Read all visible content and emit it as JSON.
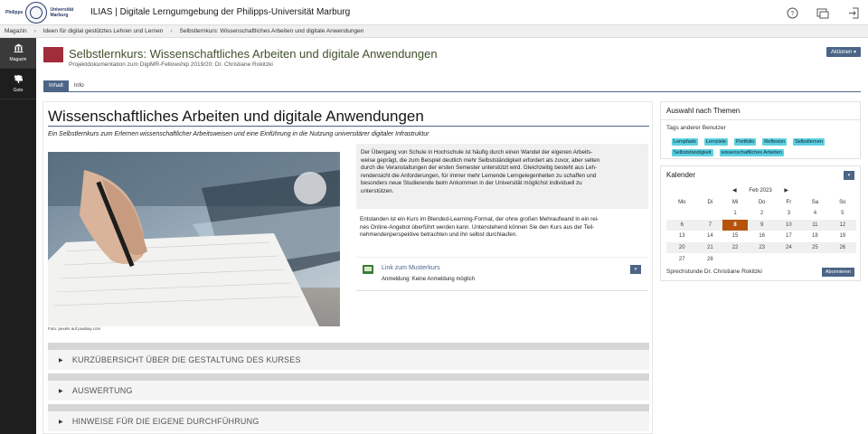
{
  "header": {
    "logo_text_left": [
      "Philipps"
    ],
    "logo_text_right": [
      "Universität",
      "Marburg"
    ],
    "title": "ILIAS | Digitale Lerngumgebung der Philipps-Universität Marburg",
    "icons": [
      "help-icon",
      "notification-icon",
      "logout-icon"
    ]
  },
  "breadcrumb": {
    "items": [
      "Magazin",
      "Ideen für digital gestütztes Lehren und Lernen",
      "Selbstlernkurs: Wissenschaftliches Arbeiten und digitale Anwendungen"
    ]
  },
  "mainbar": {
    "items": [
      {
        "label": "Magazin",
        "icon": "repository-icon"
      },
      {
        "label": "Goto",
        "icon": "signpost-icon"
      }
    ]
  },
  "object": {
    "title": "Selbstlernkurs: Wissenschaftliches Arbeiten und digitale Anwendungen",
    "description": "Projektdokumentation zum DigiMR-Fellowship 2019/20: Dr. Christiane Rokitzki",
    "actions_label": "Aktionen ▾",
    "icon_color": "#a12d3a"
  },
  "tabs": [
    {
      "label": "Inhalt",
      "active": true
    },
    {
      "label": "Info",
      "active": false
    }
  ],
  "content": {
    "heading": "Wissenschaftliches Arbeiten und digitale Anwendungen",
    "subtitle": "Ein Selbstlernkurs zum Erlernen wissenschaftlicher Arbeitsweisen und eine Einführung in die Nutzung universitärer digitaler Infrastruktur",
    "photo_caption": "Foto: pexels auf pixabay.com",
    "infobox_lines": [
      "Der Übergang von Schule in Hochschule ist häufig durch einen Wandel der eigenen Arbeits-",
      "weise geprägt, die zum Beispiel deutlich mehr Selbstständigkeit erfordert als zuvor, aber selten",
      "durch die Veranstaltungen der ersten Semester unterstützt wird. Gleichzeitig besteht aus Leh-",
      "rendensicht die Anforderungen, für immer mehr Lernende Lerngelegenheiten zu schaffen und",
      "besonders neue Studierende beim Ankommen in der Universität möglichst individuell zu",
      "unterstützen."
    ],
    "para2_lines": [
      "Entstanden ist ein Kurs im Blended-Learning-Format, der ohne großen Mehraufwand in ein rei-",
      "nes Online-Angebot überführt werden kann. Untenstehend können Sie den Kurs aus der Teil-",
      "nehmendenperspektive betrachten und ihn selbst durchlaufen."
    ],
    "link_item": {
      "title": "Link zum Musterkurs",
      "status": "Anmeldung: Keine Anmeldung möglich"
    },
    "accordions": [
      "KURZÜBERSICHT ÜBER DIE GESTALTUNG DES KURSES",
      "AUSWERTUNG",
      "HINWEISE FÜR DIE EIGENE DURCHFÜHRUNG"
    ]
  },
  "tags_slate": {
    "title": "Auswahl nach Themen",
    "label": "Tags anderer Benutzer",
    "tags": [
      "Lernpfade",
      "Lernziele",
      "Portfolio",
      "Reflexion",
      "Selbstlernen",
      "Selbstständigkeit",
      "wissenschaftliches Arbeiten"
    ]
  },
  "calendar": {
    "title": "Kalender",
    "month": "Feb 2023",
    "prev": "◀",
    "next": "▶",
    "weekdays": [
      "Mo",
      "Di",
      "Mi",
      "Do",
      "Fr",
      "Sa",
      "So"
    ],
    "weeks": [
      [
        "",
        "",
        "1",
        "2",
        "3",
        "4",
        "5"
      ],
      [
        "6",
        "7",
        "8",
        "9",
        "10",
        "11",
        "12"
      ],
      [
        "13",
        "14",
        "15",
        "16",
        "17",
        "18",
        "19"
      ],
      [
        "20",
        "21",
        "22",
        "23",
        "24",
        "25",
        "26"
      ],
      [
        "27",
        "28",
        "",
        "",
        "",
        "",
        ""
      ]
    ],
    "today": "8",
    "event_label": "Sprechstunde Dr. Christiane Rokitzki",
    "subscribe_label": "Abonnieren"
  }
}
